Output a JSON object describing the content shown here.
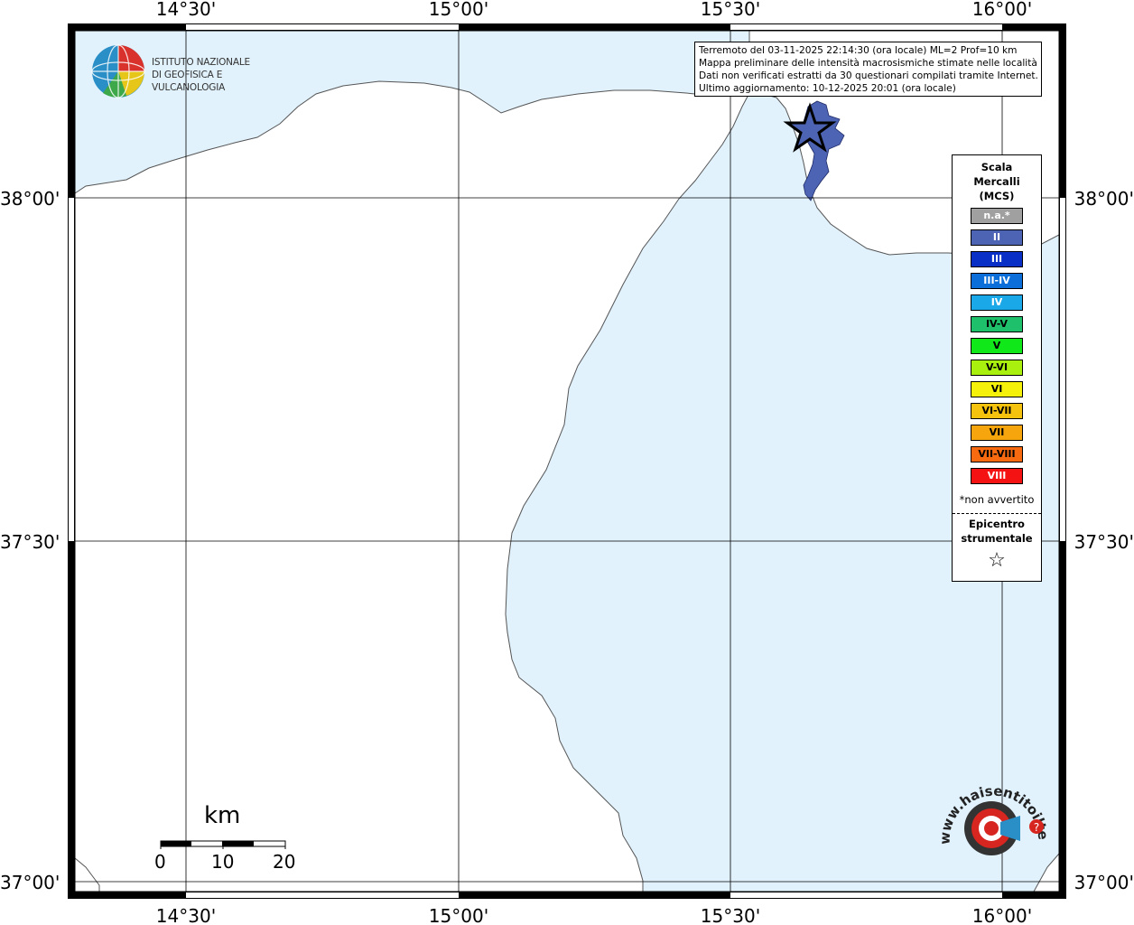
{
  "map": {
    "lon_ticks_top": [
      "14°30'",
      "15°00'",
      "15°30'",
      "16°00'"
    ],
    "lon_ticks_bottom": [
      "14°30'",
      "15°00'",
      "15°30'",
      "16°00'"
    ],
    "lat_ticks_left": [
      "38°00'",
      "37°30'",
      "37°00'"
    ],
    "lat_ticks_right": [
      "38°00'",
      "37°30'",
      "37°00'"
    ],
    "sea_color": "#e1f2fd",
    "land_color": "#ffffff",
    "felt_area_color": "#4d63b3"
  },
  "info_box": {
    "lines": [
      "Terremoto del 03-11-2025 22:14:30 (ora locale) ML=2 Prof=10 km",
      "Mappa preliminare delle intensità macrosismiche stimate nelle località",
      "Dati non verificati estratti da 30 questionari compilati tramite Internet.",
      "Ultimo aggiornamento: 10-12-2025 20:01 (ora locale)"
    ]
  },
  "legend": {
    "title_lines": [
      "Scala",
      "Mercalli",
      "(MCS)"
    ],
    "items": [
      {
        "label": "n.a.*",
        "color": "#a0a0a0",
        "text_color": "#ffffff"
      },
      {
        "label": "II",
        "color": "#4d63b3",
        "text_color": "#ffffff"
      },
      {
        "label": "III",
        "color": "#0a2fc7",
        "text_color": "#ffffff"
      },
      {
        "label": "III-IV",
        "color": "#0b6ed9",
        "text_color": "#ffffff"
      },
      {
        "label": "IV",
        "color": "#1ba8e8",
        "text_color": "#ffffff"
      },
      {
        "label": "IV-V",
        "color": "#1ec06b",
        "text_color": "#000000"
      },
      {
        "label": "V",
        "color": "#11e81a",
        "text_color": "#000000"
      },
      {
        "label": "V-VI",
        "color": "#aaf00e",
        "text_color": "#000000"
      },
      {
        "label": "VI",
        "color": "#f5f10b",
        "text_color": "#000000"
      },
      {
        "label": "VI-VII",
        "color": "#f5c20d",
        "text_color": "#000000"
      },
      {
        "label": "VII",
        "color": "#f6a50d",
        "text_color": "#000000"
      },
      {
        "label": "VII-VIII",
        "color": "#f86a0f",
        "text_color": "#000000"
      },
      {
        "label": "VIII",
        "color": "#f51212",
        "text_color": "#ffffff"
      }
    ],
    "footnote": "*non avvertito",
    "epicenter_lines": [
      "Epicentro",
      "strumentale"
    ]
  },
  "logo": {
    "name_lines": [
      "ISTITUTO NAZIONALE",
      "DI GEOFISICA E VULCANOLOGIA"
    ]
  },
  "scalebar": {
    "unit": "km",
    "labels": [
      "0",
      "10",
      "20"
    ]
  },
  "hst_logo": {
    "text": "www.haisentitoilterremoto.it",
    "red": "#d6261f"
  }
}
